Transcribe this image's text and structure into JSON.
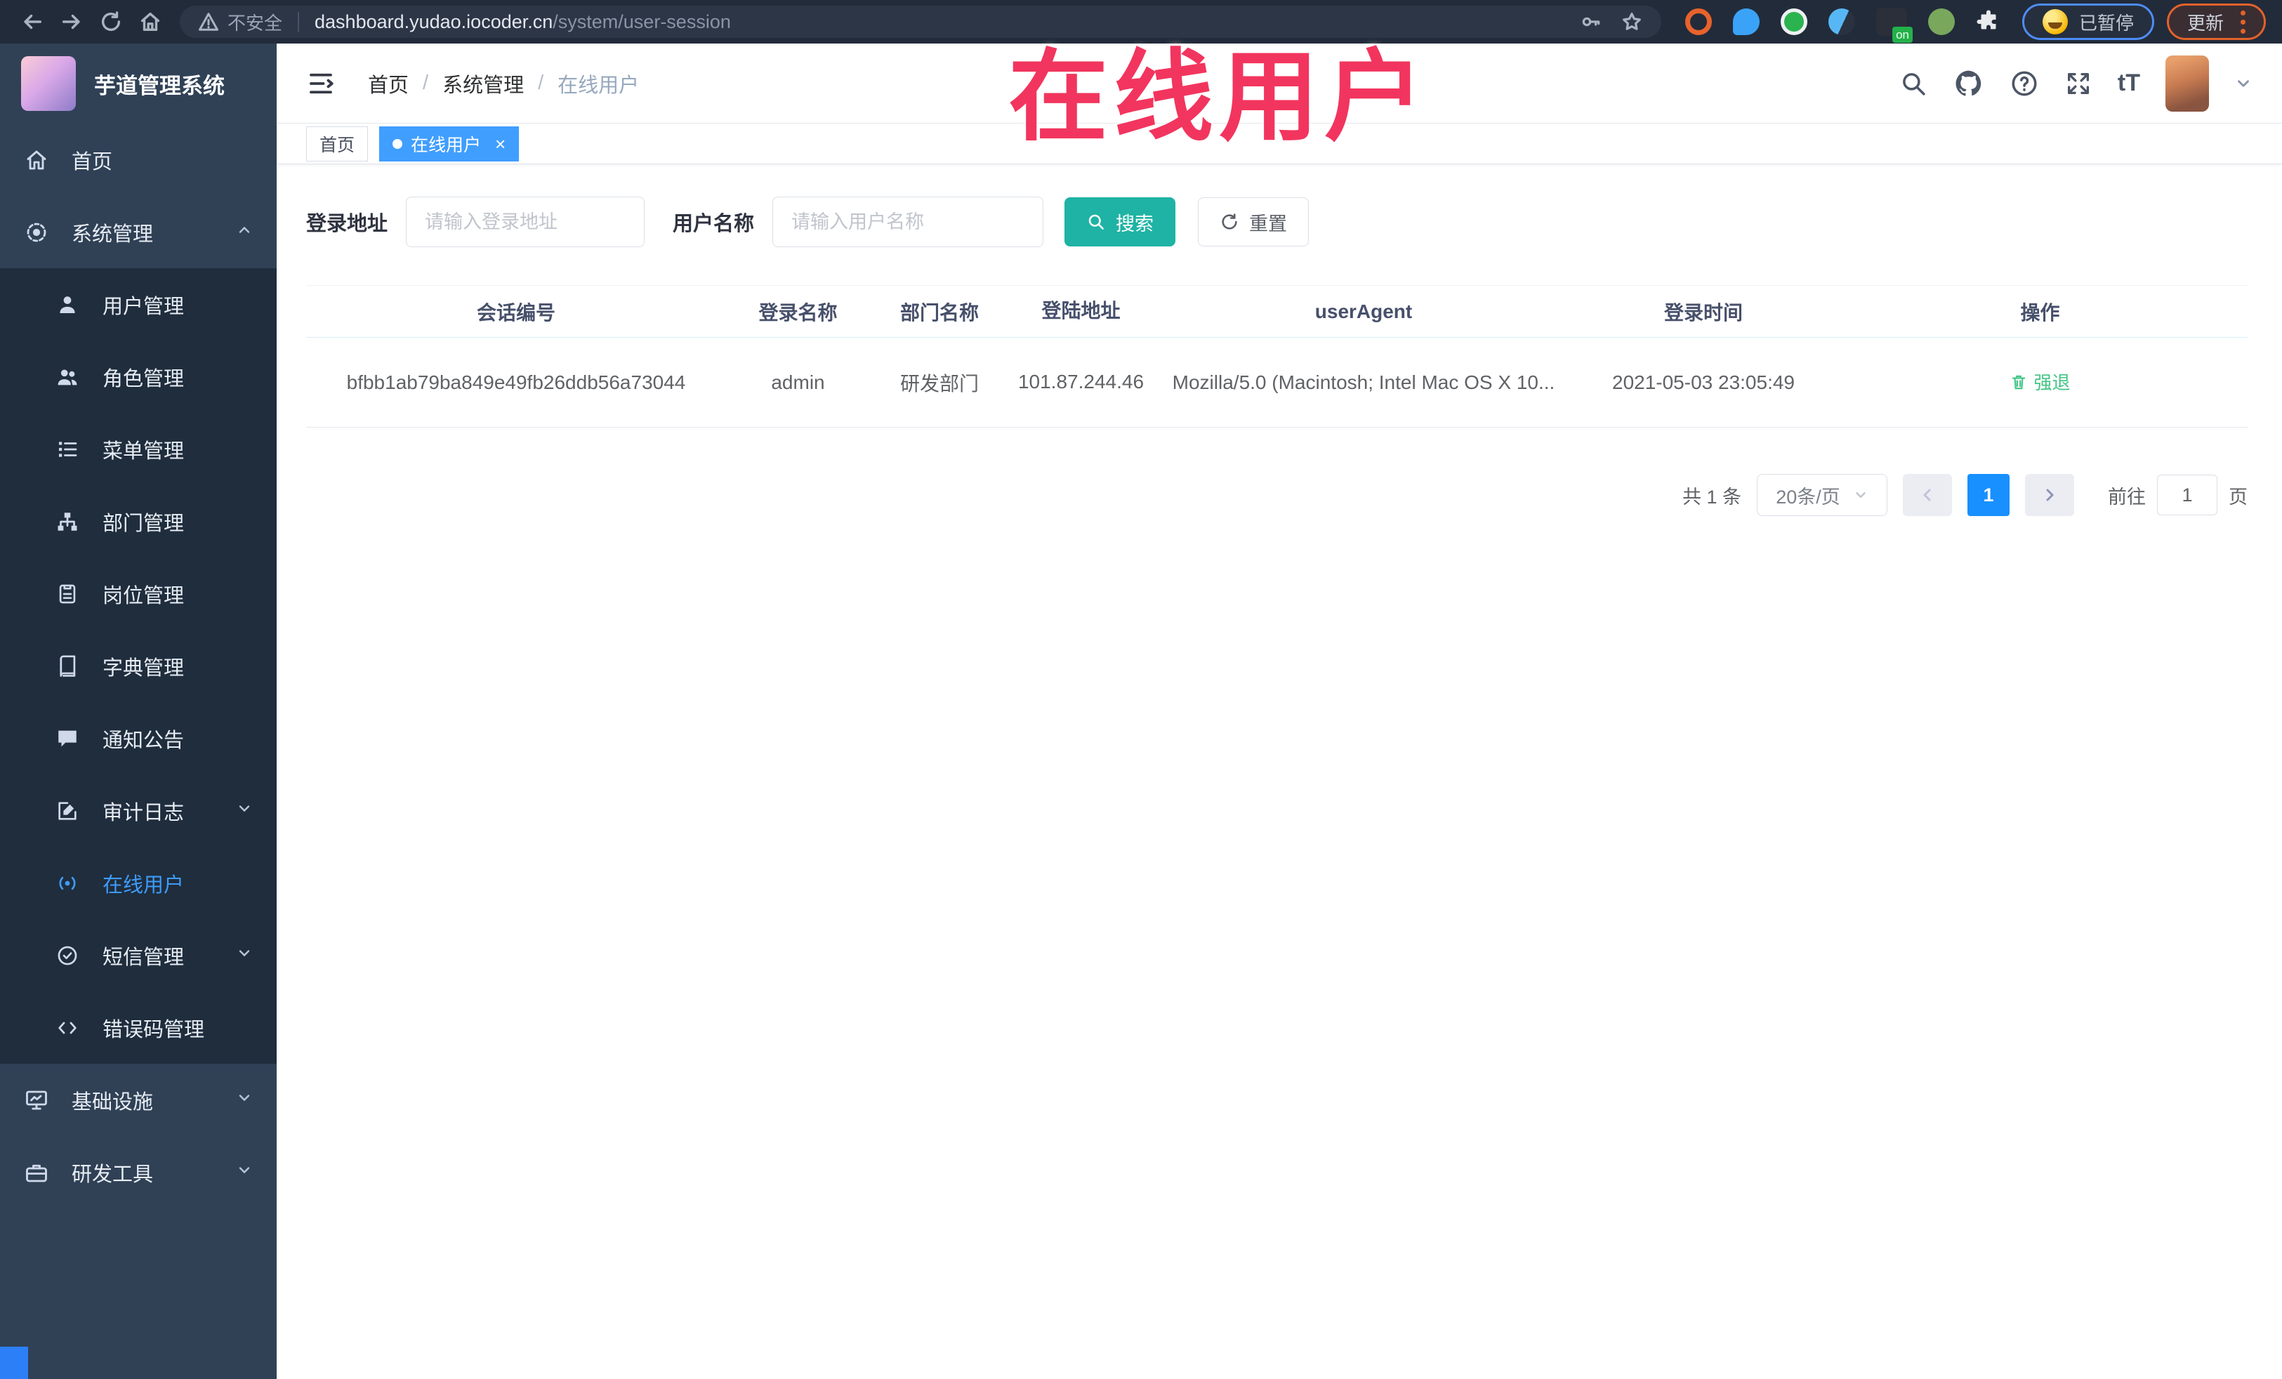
{
  "colors": {
    "accent_blue": "#409eff",
    "pagination_blue": "#1890ff",
    "sidebar_bg": "#304156",
    "submenu_bg": "#1f2d3d",
    "search_button_teal": "#1eb3a4",
    "action_green": "#42c584",
    "watermark_red": "#f2355e",
    "browser_bar": "#222b3a"
  },
  "browser": {
    "insecure_label": "不安全",
    "url_host": "dashboard.yudao.iocoder.cn",
    "url_path": "/system/user-session",
    "ext_on_badge": "on",
    "paused_label": "已暂停",
    "update_label": "更新"
  },
  "annotation": {
    "watermark": "在线用户"
  },
  "app": {
    "title": "芋道管理系统"
  },
  "header": {
    "breadcrumb": [
      "首页",
      "系统管理",
      "在线用户"
    ],
    "breadcrumb_separator": "/",
    "font_size_icon_label": "tT"
  },
  "tags": {
    "home": "首页",
    "active": "在线用户",
    "close_glyph": "×"
  },
  "filters": {
    "login_address_label": "登录地址",
    "login_address_placeholder": "请输入登录地址",
    "username_label": "用户名称",
    "username_placeholder": "请输入用户名称",
    "search_label": "搜索",
    "reset_label": "重置"
  },
  "table": {
    "columns": [
      "会话编号",
      "登录名称",
      "部门名称",
      "登陆地址",
      "userAgent",
      "登录时间",
      "操作"
    ],
    "row": {
      "session_id": "bfbb1ab79ba849e49fb26ddb56a73044",
      "login_name": "admin",
      "dept_name": "研发部门",
      "login_ip": "101.87.244.46",
      "user_agent": "Mozilla/5.0 (Macintosh; Intel Mac OS X 10...",
      "login_time": "2021-05-03 23:05:49",
      "action": "强退"
    }
  },
  "pagination": {
    "total": "共 1 条",
    "page_size": "20条/页",
    "current_page": "1",
    "goto_label": "前往",
    "goto_value": "1",
    "page_unit_label": "页"
  },
  "sidebar": {
    "menu": [
      {
        "label": "首页"
      },
      {
        "label": "系统管理"
      },
      {
        "label": "用户管理"
      },
      {
        "label": "角色管理"
      },
      {
        "label": "菜单管理"
      },
      {
        "label": "部门管理"
      },
      {
        "label": "岗位管理"
      },
      {
        "label": "字典管理"
      },
      {
        "label": "通知公告"
      },
      {
        "label": "审计日志"
      },
      {
        "label": "在线用户"
      },
      {
        "label": "短信管理"
      },
      {
        "label": "错误码管理"
      },
      {
        "label": "基础设施"
      },
      {
        "label": "研发工具"
      }
    ]
  }
}
